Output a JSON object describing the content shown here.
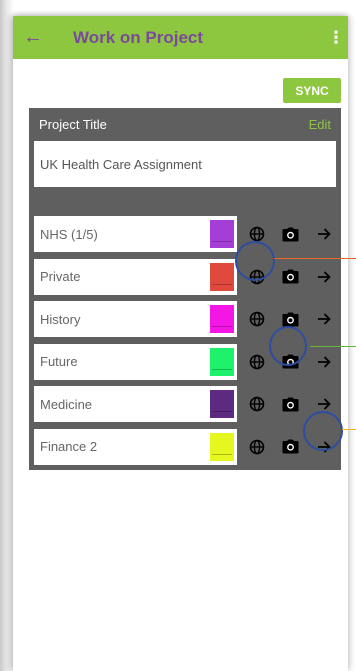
{
  "appbar": {
    "title": "Work on Project",
    "back_icon": "arrow-left-icon",
    "more_icon": "more-vertical-icon",
    "color": "#8dc63f",
    "title_color": "#7b4a9b"
  },
  "toolbar": {
    "sync_label": "SYNC"
  },
  "project": {
    "header_label": "Project Title",
    "edit_label": "Edit",
    "title_value": "UK Health Care Assignment"
  },
  "sections": [
    {
      "label": "NHS (1/5)",
      "color": "#a43ed7"
    },
    {
      "label": "Private",
      "color": "#e04a3d"
    },
    {
      "label": "History",
      "color": "#f316e4"
    },
    {
      "label": "Future",
      "color": "#1ef26a"
    },
    {
      "label": "Medicine",
      "color": "#5c2a80"
    },
    {
      "label": "Finance 2",
      "color": "#e5f71f"
    }
  ],
  "row_icons": [
    "globe-icon",
    "camera-icon",
    "arrow-right-icon"
  ],
  "annotations": {
    "circle_color": "#2f4da0",
    "pointer_colors": [
      "#e8661e",
      "#69b53b",
      "#f2b21c"
    ]
  }
}
